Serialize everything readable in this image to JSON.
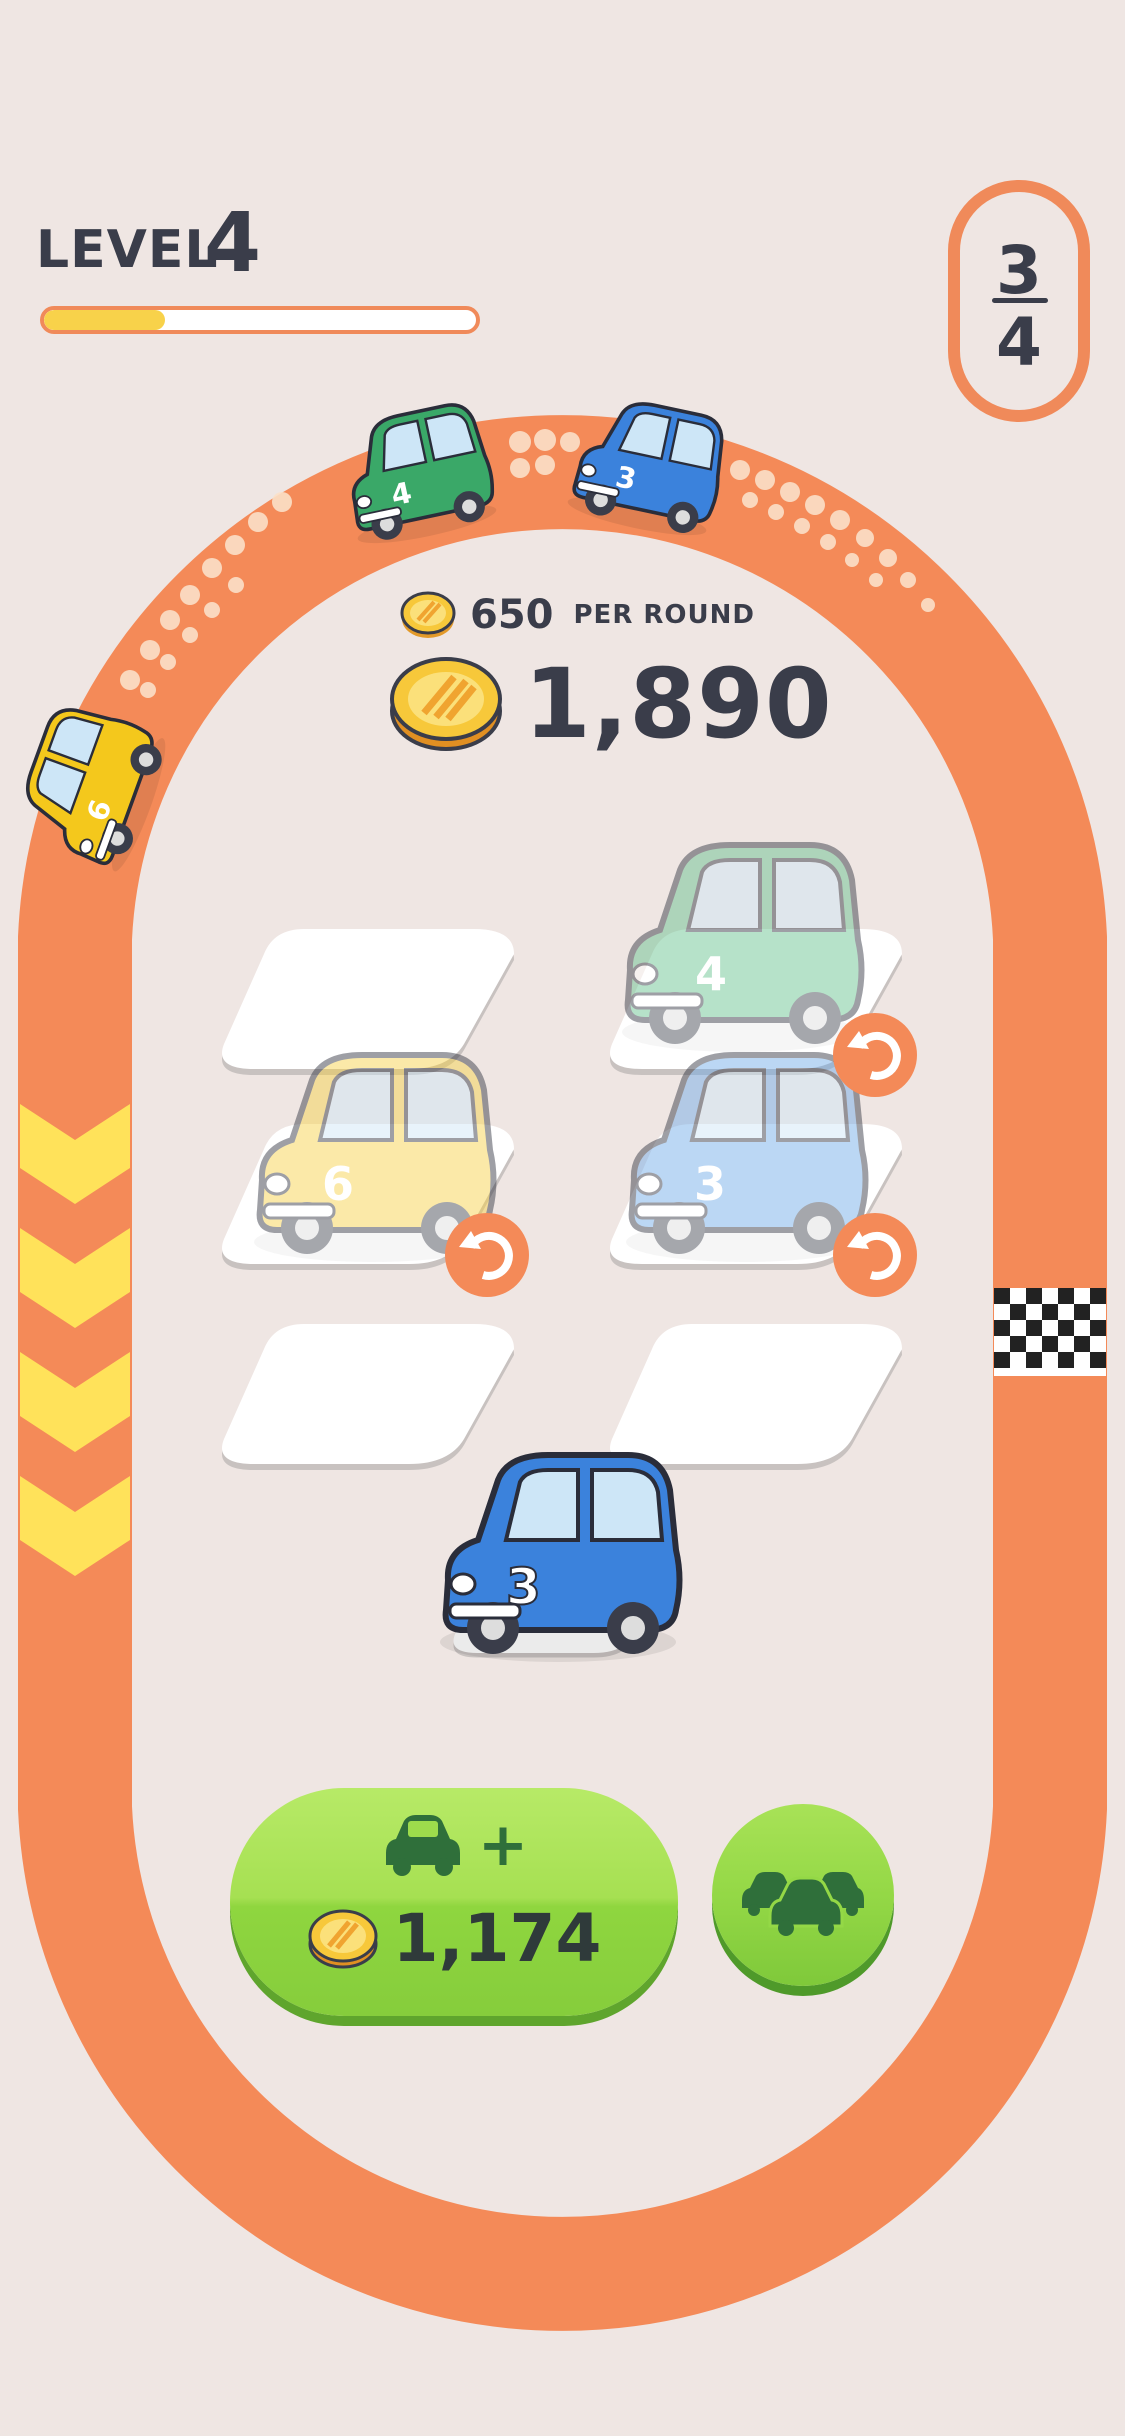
{
  "header": {
    "level_label": "LEVEL",
    "level_number": "4",
    "level_progress": 0.28
  },
  "round": {
    "current": "3",
    "total": "4"
  },
  "economy": {
    "per_round_value": "650",
    "per_round_label": "PER ROUND",
    "balance": "1,890"
  },
  "track_cars": [
    {
      "number": "4",
      "color": "green"
    },
    {
      "number": "3",
      "color": "blue"
    },
    {
      "number": "6",
      "color": "yellow"
    }
  ],
  "parking_slots": [
    {
      "slot": 1,
      "state": "empty"
    },
    {
      "slot": 2,
      "car_number": "4",
      "color": "green",
      "state": "racing"
    },
    {
      "slot": 3,
      "car_number": "6",
      "color": "yellow",
      "state": "racing"
    },
    {
      "slot": 4,
      "car_number": "3",
      "color": "blue",
      "state": "racing"
    },
    {
      "slot": 5,
      "state": "empty"
    },
    {
      "slot": 6,
      "state": "empty"
    }
  ],
  "new_car": {
    "number": "3",
    "color": "blue"
  },
  "buy_button": {
    "plus_symbol": "+",
    "price": "1,174"
  },
  "colors": {
    "track": "#f48a58",
    "background": "#efe6e3",
    "button_green": "#9ddc4c",
    "coin": "#f7c83a",
    "chevron": "#ffe25a"
  }
}
